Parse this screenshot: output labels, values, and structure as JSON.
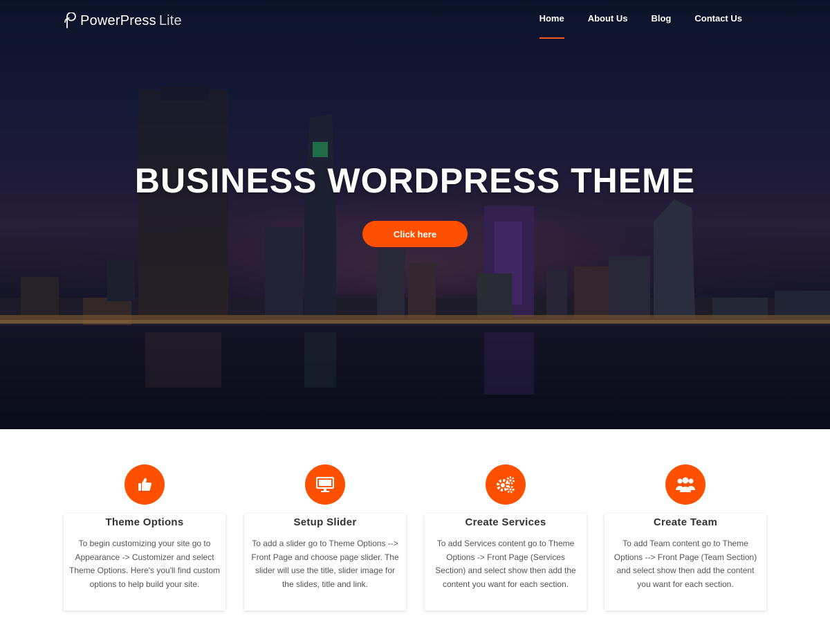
{
  "site": {
    "logo_main": "PowerPress",
    "logo_sub": "Lite"
  },
  "nav": {
    "items": [
      {
        "label": "Home",
        "active": true
      },
      {
        "label": "About Us",
        "active": false
      },
      {
        "label": "Blog",
        "active": false
      },
      {
        "label": "Contact Us",
        "active": false
      }
    ]
  },
  "hero": {
    "title": "BUSINESS WORDPRESS THEME",
    "button_label": "Click here"
  },
  "features": [
    {
      "icon": "thumbs-up-icon",
      "title": "Theme Options",
      "text": "To begin customizing your site go to Appearance -> Customizer and select Theme Options. Here's you'll find custom options to help build your site."
    },
    {
      "icon": "monitor-icon",
      "title": "Setup Slider",
      "text": "To add a slider go to Theme Options --> Front Page and choose page slider. The slider will use the title, slider image for the slides, title and link."
    },
    {
      "icon": "gears-icon",
      "title": "Create Services",
      "text": "To add Services content go to Theme Options -> Front Page (Services Section) and select show then add the content you want for each section."
    },
    {
      "icon": "team-icon",
      "title": "Create Team",
      "text": "To add Team content go to Theme Options --> Front Page (Team Section) and select show then add the content you want for each section."
    }
  ],
  "colors": {
    "accent": "#ff5000",
    "nav_underline": "#ff5a1f",
    "hero_bg": "#1a2040"
  }
}
